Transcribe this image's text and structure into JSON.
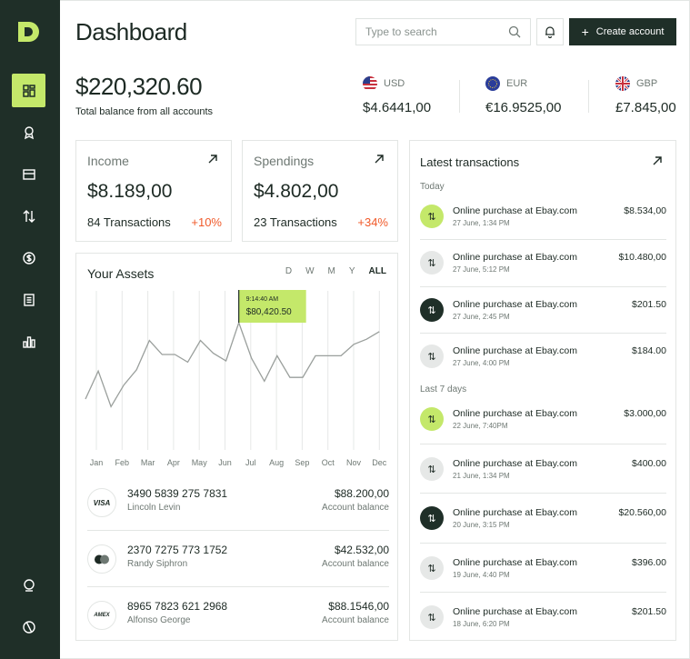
{
  "header": {
    "title": "Dashboard",
    "search_placeholder": "Type to search",
    "create_label": "Create account"
  },
  "sidebar": {
    "items": [
      "dashboard-icon",
      "award-icon",
      "card-icon",
      "transfer-icon",
      "dollar-icon",
      "document-icon",
      "bar-chart-icon"
    ],
    "bottom_items": [
      "profile-icon",
      "logout-icon"
    ],
    "active_index": 0
  },
  "balance": {
    "amount": "$220,320.60",
    "label": "Total balance from all accounts"
  },
  "currencies": [
    {
      "code": "USD",
      "value": "$4.6441,00",
      "flag": "us-flag-icon"
    },
    {
      "code": "EUR",
      "value": "€16.9525,00",
      "flag": "eu-flag-icon"
    },
    {
      "code": "GBP",
      "value": "£7.845,00",
      "flag": "uk-flag-icon"
    }
  ],
  "income": {
    "title": "Income",
    "value": "$8.189,00",
    "transactions": "84 Transactions",
    "change": "+10%"
  },
  "spendings": {
    "title": "Spendings",
    "value": "$4.802,00",
    "transactions": "23 Transactions",
    "change": "+34%"
  },
  "assets": {
    "title": "Your Assets",
    "periods": [
      "D",
      "W",
      "M",
      "Y",
      "ALL"
    ],
    "active_period": "ALL",
    "tooltip_time": "9:14:40 AM",
    "tooltip_value": "$80,420.50"
  },
  "chart_data": {
    "type": "line",
    "x": [
      "Jan",
      "Feb",
      "Mar",
      "Apr",
      "May",
      "Jun",
      "Jul",
      "Aug",
      "Sep",
      "Oct",
      "Nov",
      "Dec"
    ],
    "y": [
      40,
      62,
      34,
      51,
      63,
      86,
      75,
      75,
      69,
      86,
      76,
      70,
      100,
      72,
      54,
      74,
      57,
      57,
      74,
      74,
      74,
      83,
      87,
      93
    ],
    "ylim": [
      0,
      100
    ],
    "highlight": {
      "value": "$80,420.50",
      "time": "9:14:40 AM"
    },
    "colors": {
      "line": "#9a9f9c",
      "highlight": "#c4e86a"
    }
  },
  "accounts": [
    {
      "number": "3490 5839 275 7831",
      "name": "Lincoln Levin",
      "amount": "$88.200,00",
      "label": "Account balance",
      "brand": "VISA"
    },
    {
      "number": "2370 7275 773 1752",
      "name": "Randy Siphron",
      "amount": "$42.532,00",
      "label": "Account balance",
      "brand": "mastercard"
    },
    {
      "number": "8965 7823 621 2968",
      "name": "Alfonso George",
      "amount": "$88.1546,00",
      "label": "Account balance",
      "brand": "AMEX"
    }
  ],
  "transactions": {
    "title": "Latest transactions",
    "today_label": "Today",
    "week_label": "Last 7 days",
    "today": [
      {
        "desc": "Online purchase at Ebay.com",
        "date": "27 June, 1:34 PM",
        "amount": "$8.534,00",
        "style": "lime"
      },
      {
        "desc": "Online purchase at Ebay.com",
        "date": "27 June, 5:12 PM",
        "amount": "$10.480,00",
        "style": "grey"
      },
      {
        "desc": "Online purchase at Ebay.com",
        "date": "27 June, 2:45 PM",
        "amount": "$201.50",
        "style": "dark"
      },
      {
        "desc": "Online purchase at Ebay.com",
        "date": "27 June, 4:00 PM",
        "amount": "$184.00",
        "style": "grey"
      }
    ],
    "week": [
      {
        "desc": "Online purchase at Ebay.com",
        "date": "22 June, 7:40PM",
        "amount": "$3.000,00",
        "style": "lime"
      },
      {
        "desc": "Online purchase at Ebay.com",
        "date": "21 June, 1:34 PM",
        "amount": "$400.00",
        "style": "grey"
      },
      {
        "desc": "Online purchase at Ebay.com",
        "date": "20 June, 3:15 PM",
        "amount": "$20.560,00",
        "style": "dark"
      },
      {
        "desc": "Online purchase at Ebay.com",
        "date": "19 June, 4:40 PM",
        "amount": "$396.00",
        "style": "grey"
      },
      {
        "desc": "Online purchase at Ebay.com",
        "date": "18 June, 6:20 PM",
        "amount": "$201.50",
        "style": "grey"
      }
    ]
  }
}
